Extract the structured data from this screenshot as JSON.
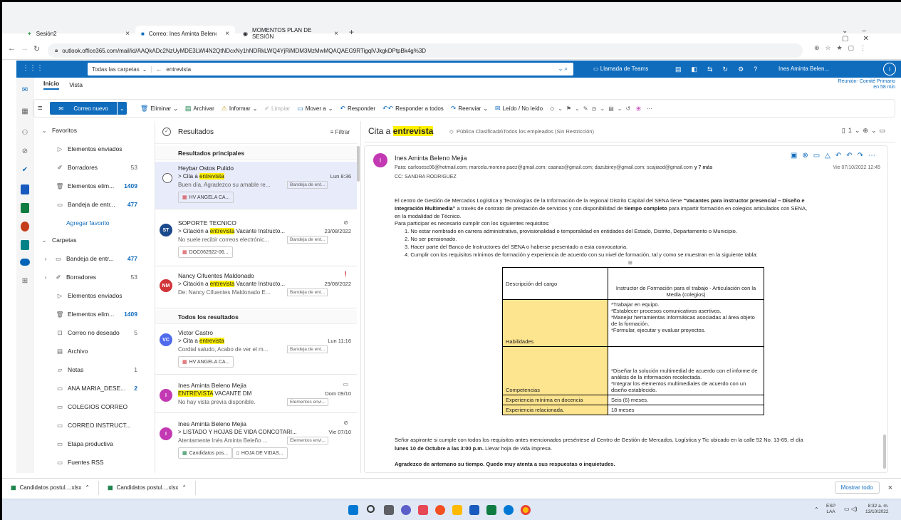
{
  "browser": {
    "tabs": [
      "Sesión2",
      "Correo: Ines Aminta Beleno Mejí",
      "MOMENTOS PLAN DE SESIÓN"
    ],
    "url": "outlook.office365.com/mail/id/AAQkADc2NzUyMDE3LWI4N2QtNDcxNy1hNDRkLWQ4YjRiMDM3MzMwMQAQAEG9RTigqlVJkgkDPtpBk4g%3D"
  },
  "header": {
    "folder_scope": "Todas las carpetas",
    "search_value": "entrevista",
    "teams_label": "Llamada de Teams",
    "user_name": "Ines Aminta Belen..."
  },
  "ribbon": {
    "tabs": [
      "Inicio",
      "Vista"
    ],
    "new_mail": "Correo nuevo",
    "delete": "Eliminar",
    "archive": "Archivar",
    "report": "Informar",
    "clean": "Limpiar",
    "move": "Mover a",
    "reply": "Responder",
    "reply_all": "Responder a todos",
    "forward": "Reenviar",
    "read_unread": "Leído / No leído",
    "reminder": "Reunión- Comité Primario",
    "reminder_time": "en 58 min"
  },
  "folders": {
    "favorites": "Favoritos",
    "fav_items": [
      {
        "label": "Elementos enviados",
        "count": ""
      },
      {
        "label": "Borradores",
        "count": "53"
      },
      {
        "label": "Elementos elim...",
        "count": "1409"
      },
      {
        "label": "Bandeja de entr...",
        "count": "477"
      }
    ],
    "add_favorite": "Agregar favorito",
    "carpetas": "Carpetas",
    "items": [
      {
        "label": "Bandeja de entr...",
        "count": "477"
      },
      {
        "label": "Borradores",
        "count": "53"
      },
      {
        "label": "Elementos enviados",
        "count": ""
      },
      {
        "label": "Elementos elim...",
        "count": "1409"
      },
      {
        "label": "Correo no deseado",
        "count": "5"
      },
      {
        "label": "Archivo",
        "count": ""
      },
      {
        "label": "Notas",
        "count": "1"
      },
      {
        "label": "ANA MARIA_DESE...",
        "count": "2"
      },
      {
        "label": "COLEGIOS CORREO",
        "count": ""
      },
      {
        "label": "CORREO INSTRUCT...",
        "count": ""
      },
      {
        "label": "Etapa productiva",
        "count": ""
      },
      {
        "label": "Fuentes RSS",
        "count": ""
      }
    ]
  },
  "list": {
    "title": "Resultados",
    "filter": "Filtrar",
    "top_results": "Resultados principales",
    "all_results": "Todos los resultados",
    "messages": [
      {
        "initials": "",
        "from": "Heybar Ostos Pulido",
        "subj_pre": "> Cita a ",
        "subj_hl": "entrevista",
        "subj_post": "",
        "date": "Lun 8:36",
        "preview": "Buen día, Agradezco su amable re...",
        "folder": "Bandeja de ent...",
        "att": "HV ANGELA CA...",
        "color": "#ffffff"
      },
      {
        "initials": "ST",
        "from": "SOPORTE TECNICO",
        "subj_pre": "> Citación a ",
        "subj_hl": "entrevista",
        "subj_post": " Vacante Instructo...",
        "date": "23/08/2022",
        "preview": "No suele recibir correos electrónic...",
        "folder": "Bandeja de ent...",
        "att": "DOC062922-06...",
        "color": "#1b4a8c"
      },
      {
        "initials": "NM",
        "from": "Nancy Cifuentes Maldonado",
        "subj_pre": "> Citación a ",
        "subj_hl": "entrevista",
        "subj_post": " Vacante Instructo...",
        "date": "29/08/2022",
        "preview": "De: Nancy Cifuentes Maldonado E...",
        "folder": "Bandeja de ent...",
        "att": "",
        "color": "#d13438"
      },
      {
        "initials": "VC",
        "from": "Victor Castro",
        "subj_pre": "> Cita a ",
        "subj_hl": "entrevista",
        "subj_post": "",
        "date": "Lun 11:16",
        "preview": "Cordial saludo, Acabo de ver el m...",
        "folder": "Bandeja de ent...",
        "att": "HV ANGELA CA...",
        "color": "#4f6bed"
      },
      {
        "initials": "I",
        "from": "Ines Aminta Beleno Mejia",
        "subj_pre": "",
        "subj_hl": "ENTREVISTA",
        "subj_post": " VACANTE DM",
        "date": "Dom 09/10",
        "preview": "No hay vista previa disponible.",
        "folder": "Elementos envi...",
        "att": "",
        "color": "#c239b3"
      },
      {
        "initials": "I",
        "from": "Ines Aminta Beleno Mejia",
        "subj_pre": "> LISTADO Y HOJAS DE VIDA CONCOTARI...",
        "subj_hl": "",
        "subj_post": "",
        "date": "Vie 07/10",
        "preview": "Atentamente Inés Aminta Beleño ...",
        "folder": "Elementos envi...",
        "att": "Candidatos pos...",
        "att2": "HOJA DE VIDAS...",
        "color": "#c239b3"
      }
    ]
  },
  "reading": {
    "subject_pre": "Cita a ",
    "subject_hl": "entrevista",
    "classification": "Pública Clasificada\\Todos los empleados (Sin Restricción)",
    "sender": "Ines Aminta Beleno Mejia",
    "to": "Para:  carlosesc06@hotmail.com;  marcela.moreno.paez@gmail.com;  caarias@gmail.com;  dazubirey@gmail.com;  scajiaod@gmail.com",
    "to_more": " y 7 más",
    "sent": "Vie 07/10/2022 12:45",
    "cc": "CC:  SANDRA RODRIGUEZ",
    "p1a": "El centro de Gestión de Mercados Logística y Tecnologías de la Información de la regional Distrito Capital del SENA tiene ",
    "p1b": "“Vacantes para instructor presencial – Diseño e",
    "p1c": "Integración Multimedia”",
    "p1d": " a través de contrato de prestación de servicios y con disponibilidad de ",
    "p1e": "tiempo completo",
    "p1f": " para impartir formación en colegios articulados con SENA,",
    "p1g": "en la modalidad de Técnico.",
    "p2": "Para participar es necesario cumplir con los siguientes requisitos:",
    "reqs": [
      "1. No estar nombrado en carrera administrativa, provisionalidad o temporalidad en entidades del Estado, Distrito, Departamento o Municipio.",
      "2. No ser pensionado.",
      "3. Hacer parte del Banco de Instructores del SENA o haberse presentado a esta convocatoria.",
      "4. Cumplir con los requisitos mínimos de formación y experiencia de acuerdo con su nivel de formación, tal y como se muestran en la siguiente tabla:"
    ],
    "table": {
      "r1a": "Descripción del cargo",
      "r1b": "Instructor de Formación para el trabajo - Articulación con la Media (colegios)",
      "r2a": "Habilidades",
      "r2b": [
        "*Trabajar en equipo.",
        "*Establecer procesos comunicativos asertivos.",
        "*Manejar herramientas informáticas asociadas al área objeto de la formación.",
        "*Formular, ejecutar y evaluar proyectos."
      ],
      "r3a": "Competencias",
      "r3b": [
        "*Diseñar la solución multimedial de acuerdo con el informe de análisis de la información recolectada.",
        "*Integrar los elementos multimediales de acuerdo con un diseño establecido."
      ],
      "r4a": "Experiencia mínima en docencia",
      "r4b": "Seis (6) meses.",
      "r5a": "Experiencia relacionada.",
      "r5b": "18 meses"
    },
    "p3": "Señor aspirante si cumple con todos los requisitos antes mencionados preséntese al Centro de Gestión de Mercados, Logística y Tic ubicado en la calle 52 No. 13-65, el día",
    "p3b": "lunes 10 de Octubre a las 3:00 p.m.",
    "p3c": " Llevar hoja de vida impresa.",
    "p4": "Agradezco de antemano su tiempo. Quedo muy atenta a sus respuestas o inquietudes."
  },
  "downloads": {
    "items": [
      "Candidatos postul....xlsx",
      "Candidatos postul....xlsx"
    ],
    "show_all": "Mostrar todo"
  },
  "taskbar": {
    "lang": "ESP",
    "lang2": "LAA",
    "time": "8:32 a. m.",
    "date": "13/10/2022"
  }
}
